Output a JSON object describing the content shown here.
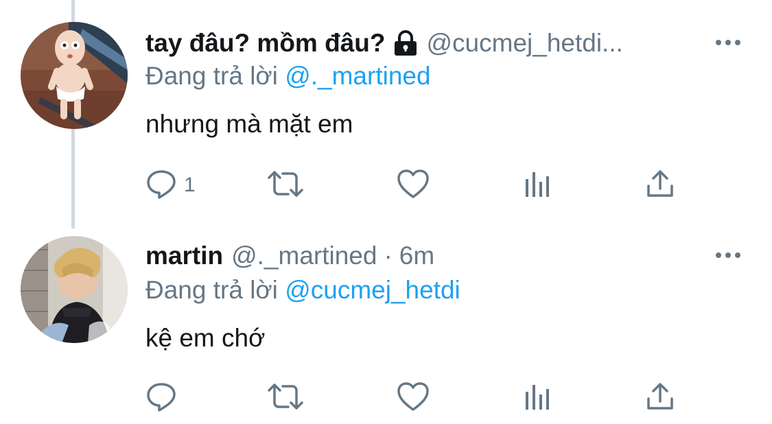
{
  "colors": {
    "text": "#14171a",
    "secondary": "#657786",
    "accent": "#1da1f2",
    "thread_line": "#cfd9de"
  },
  "tweets": [
    {
      "display_name": "tay đâu? mồm đâu?",
      "protected_icon": "lock-icon",
      "handle": "@cucmej_hetdi...",
      "replying_prefix": "Đang trả lời",
      "replying_to": "@._martined",
      "text": "nhưng mà mặt em",
      "reply_count": "1"
    },
    {
      "display_name": "martin",
      "handle": "@._martined",
      "separator": "·",
      "time": "6m",
      "replying_prefix": "Đang trả lời",
      "replying_to": "@cucmej_hetdi",
      "text": "kệ em chớ",
      "reply_count": ""
    }
  ]
}
